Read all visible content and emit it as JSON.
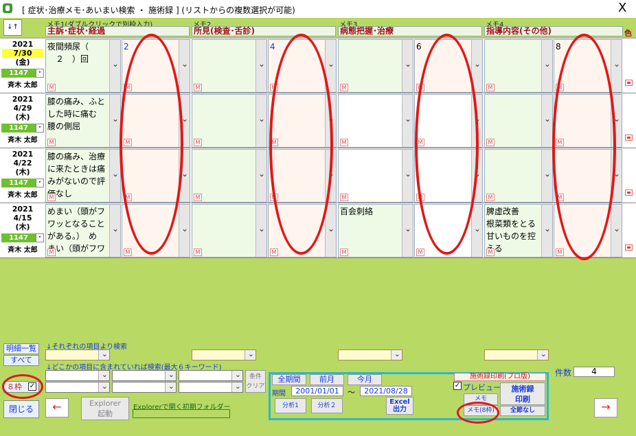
{
  "window": {
    "title": "[ 症状･治療メモ･あいまい検索 ・ 施術録 ] (リストからの複数選択が可能)",
    "close_glyph": "X"
  },
  "header": {
    "sort_label": "↓↑",
    "color_label": "色",
    "memos": [
      {
        "label": "メモ1(ダブルクリックで別枠入力)",
        "title": "主訴･症状･経過"
      },
      {
        "label": "メモ2",
        "title": "所見(検査･舌診)"
      },
      {
        "label": "メモ3",
        "title": "病態把握･治療"
      },
      {
        "label": "メモ4",
        "title": "指導内容(その他)"
      }
    ]
  },
  "rows": [
    {
      "year": "2021",
      "md": "7/30",
      "dow": "(金)",
      "id": "1147",
      "name": "斉木 太郎",
      "highlight": true,
      "c": [
        "夜間頻尿（\n　２　）回",
        "2",
        "",
        "4",
        "",
        "6",
        "",
        "8"
      ]
    },
    {
      "year": "2021",
      "md": "4/29",
      "dow": "(木)",
      "id": "1147",
      "name": "斉木 太郎",
      "highlight": false,
      "c": [
        "膝の痛み、ふと\nした時に痛む\n腰の側屈",
        "",
        "",
        "",
        "",
        "",
        "",
        ""
      ]
    },
    {
      "year": "2021",
      "md": "4/22",
      "dow": "(木)",
      "id": "1147",
      "name": "斉木 太郎",
      "highlight": false,
      "c": [
        "膝の痛み、治療\nに来たときは痛\nみがないので評\n価なし",
        "",
        "",
        "",
        "",
        "",
        "",
        ""
      ]
    },
    {
      "year": "2021",
      "md": "4/15",
      "dow": "(木)",
      "id": "1147",
      "name": "斉木 太郎",
      "highlight": false,
      "c": [
        "めまい（頭がフ\nワッとなること\nがある。）　め\nまい（頭がフワ",
        "",
        "",
        "",
        "百会刺絡",
        "",
        "脾虚改善\n根菜類をとる\n甘いものを控\nえる",
        ""
      ]
    }
  ],
  "m_label": "M",
  "dot_label": "･",
  "bottom": {
    "detail_list": "明細一覧",
    "all": "すべて",
    "frame8": "８枠",
    "close": "閉じる",
    "search_each": "↓それぞれの項目より検索",
    "search_any": "↓どこかの項目に含まれていれば検索(最大６キーワード)",
    "cond_clear": "条件\nクリア",
    "explorer_btn": "Explorer\n起動",
    "explorer_lbl": "Explorerで開く初期フォルダー",
    "all_period": "全期間",
    "prev_month": "前月",
    "this_month": "今月",
    "period": "期間",
    "from": "2001/01/01",
    "tilde": "～",
    "to": "2021/08/28",
    "analysis1": "分析1",
    "analysis2": "分析２",
    "excel": "Excel\n出力",
    "print_title": "施術録印刷(プロ版)",
    "preview": "プレビュー",
    "memo": "メモ",
    "memo8": "メモ(8枠)",
    "record_print": "施術録\n印刷",
    "all_none": "全節なし",
    "count_label": "件数",
    "count": "4",
    "left_arrow": "←",
    "right_arrow": "→"
  }
}
